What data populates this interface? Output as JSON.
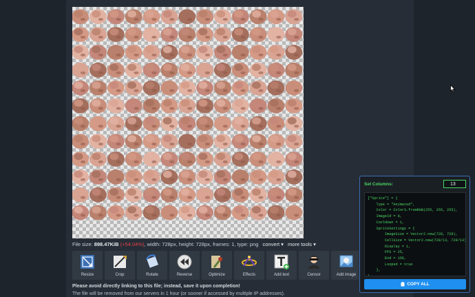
{
  "file_info": {
    "prefix": "File size: ",
    "size": "898.47KiB",
    "change": "(+54.04%)",
    "details": ", width: 728px, height: 728px, frames: 1, type: png",
    "convert_label": "convert ▾",
    "more_tools_label": "more tools ▾"
  },
  "tools": [
    {
      "label": "Resize",
      "icon": "resize-icon"
    },
    {
      "label": "Crop",
      "icon": "crop-icon"
    },
    {
      "label": "Rotate",
      "icon": "rotate-icon"
    },
    {
      "label": "Reverse",
      "icon": "reverse-icon"
    },
    {
      "label": "Optimize",
      "icon": "optimize-icon"
    },
    {
      "label": "Effects",
      "icon": "effects-icon"
    },
    {
      "label": "Add text",
      "icon": "add-text-icon"
    },
    {
      "label": "Censor",
      "icon": "censor-icon"
    },
    {
      "label": "Add image",
      "icon": "add-image-icon"
    }
  ],
  "notices": {
    "line1": "Please avoid directly linking to this file; instead, save it upon completion!",
    "line2": "The file will be removed from our servers in 1 hour (or sooner if accessed by multiple IP addresses)."
  },
  "code_panel": {
    "label": "Set Columns:",
    "columns_value": "13",
    "code": "[\"Sprite\"] = {\n    Type = \"Animated\",\n    Color = Color3.fromRGB(255, 255, 255),\n    ImageId = 0,\n    Cooldown = 1,\n    SpriteSettings = {\n        ImageSize = Vector2.new(728, 728),\n        CellSize = Vector2.new(728/13, 728/13),\n        Display = 1,\n        FPS = 25,\n        End = 156,\n        Looped = true\n    },\n},",
    "copy_label": "COPY ALL",
    "copy_icon": "clipboard-icon"
  },
  "colors": {
    "accent_green": "#4cd964",
    "accent_blue": "#1f8ff0",
    "negative_red": "#e0434a"
  },
  "preview": {
    "icon": "sprite-sheet-preview",
    "columns": 13,
    "filled_cells": 156
  }
}
